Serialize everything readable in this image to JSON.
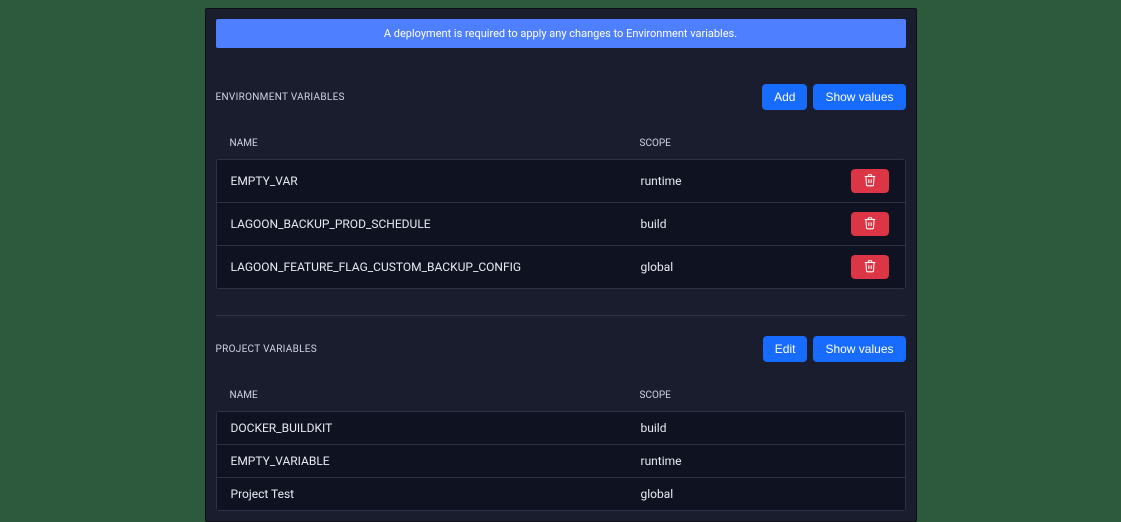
{
  "banner": {
    "text": "A deployment is required to apply any changes to Environment variables."
  },
  "env_section": {
    "title": "ENVIRONMENT VARIABLES",
    "add_label": "Add",
    "show_values_label": "Show values",
    "headers": {
      "name": "NAME",
      "scope": "SCOPE"
    },
    "rows": [
      {
        "name": "EMPTY_VAR",
        "scope": "runtime"
      },
      {
        "name": "LAGOON_BACKUP_PROD_SCHEDULE",
        "scope": "build"
      },
      {
        "name": "LAGOON_FEATURE_FLAG_CUSTOM_BACKUP_CONFIG",
        "scope": "global"
      }
    ]
  },
  "proj_section": {
    "title": "PROJECT VARIABLES",
    "edit_label": "Edit",
    "show_values_label": "Show values",
    "headers": {
      "name": "NAME",
      "scope": "SCOPE"
    },
    "rows": [
      {
        "name": "DOCKER_BUILDKIT",
        "scope": "build"
      },
      {
        "name": "EMPTY_VARIABLE",
        "scope": "runtime"
      },
      {
        "name": "Project Test",
        "scope": "global"
      }
    ]
  }
}
